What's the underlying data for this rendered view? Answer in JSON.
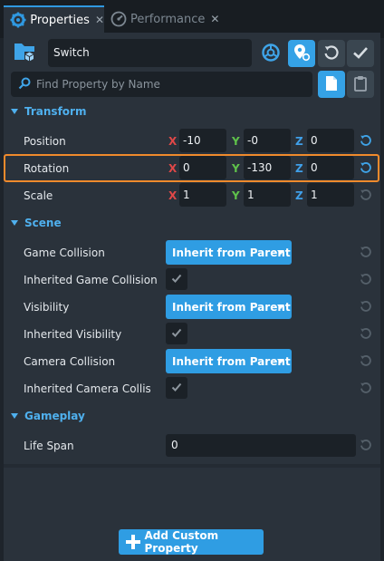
{
  "tabs": [
    {
      "label": "Properties",
      "icon": "gear-icon",
      "active": true
    },
    {
      "label": "Performance",
      "icon": "gauge-icon",
      "active": false
    }
  ],
  "object": {
    "name": "Switch",
    "icon": "folder-object-icon"
  },
  "toolbar": {
    "network_icon": "networking-icon",
    "pin_icon": "map-pin-icon",
    "reset_icon": "reset-icon",
    "check_icon": "checkmark-icon",
    "doc_icon": "document-icon",
    "clipboard_icon": "clipboard-icon"
  },
  "search": {
    "placeholder": "Find Property by Name"
  },
  "sections": {
    "transform": "Transform",
    "scene": "Scene",
    "gameplay": "Gameplay"
  },
  "transform": {
    "axes": {
      "x": "X",
      "y": "Y",
      "z": "Z"
    },
    "position": {
      "label": "Position",
      "x": "-10",
      "y": "-0",
      "z": "0"
    },
    "rotation": {
      "label": "Rotation",
      "x": "0",
      "y": "-130",
      "z": "0"
    },
    "scale": {
      "label": "Scale",
      "x": "1",
      "y": "1",
      "z": "1"
    }
  },
  "scene": {
    "game_collision": {
      "label": "Game Collision",
      "value": "Inherit from Parent"
    },
    "inherited_game_collision": {
      "label": "Inherited Game Collision",
      "checked": true
    },
    "visibility": {
      "label": "Visibility",
      "value": "Inherit from Parent"
    },
    "inherited_visibility": {
      "label": "Inherited Visibility",
      "checked": true
    },
    "camera_collision": {
      "label": "Camera Collision",
      "value": "Inherit from Parent"
    },
    "inherited_camera_collision": {
      "label": "Inherited Camera Collisic",
      "checked": true
    }
  },
  "gameplay": {
    "life_span": {
      "label": "Life Span",
      "value": "0"
    }
  },
  "footer": {
    "add_custom_property": "Add Custom Property"
  },
  "colors": {
    "accent": "#2f9de3",
    "highlight": "#f08a2c",
    "axis_x": "#e04848",
    "axis_y": "#5fc24b",
    "axis_z": "#3f9fe8"
  }
}
